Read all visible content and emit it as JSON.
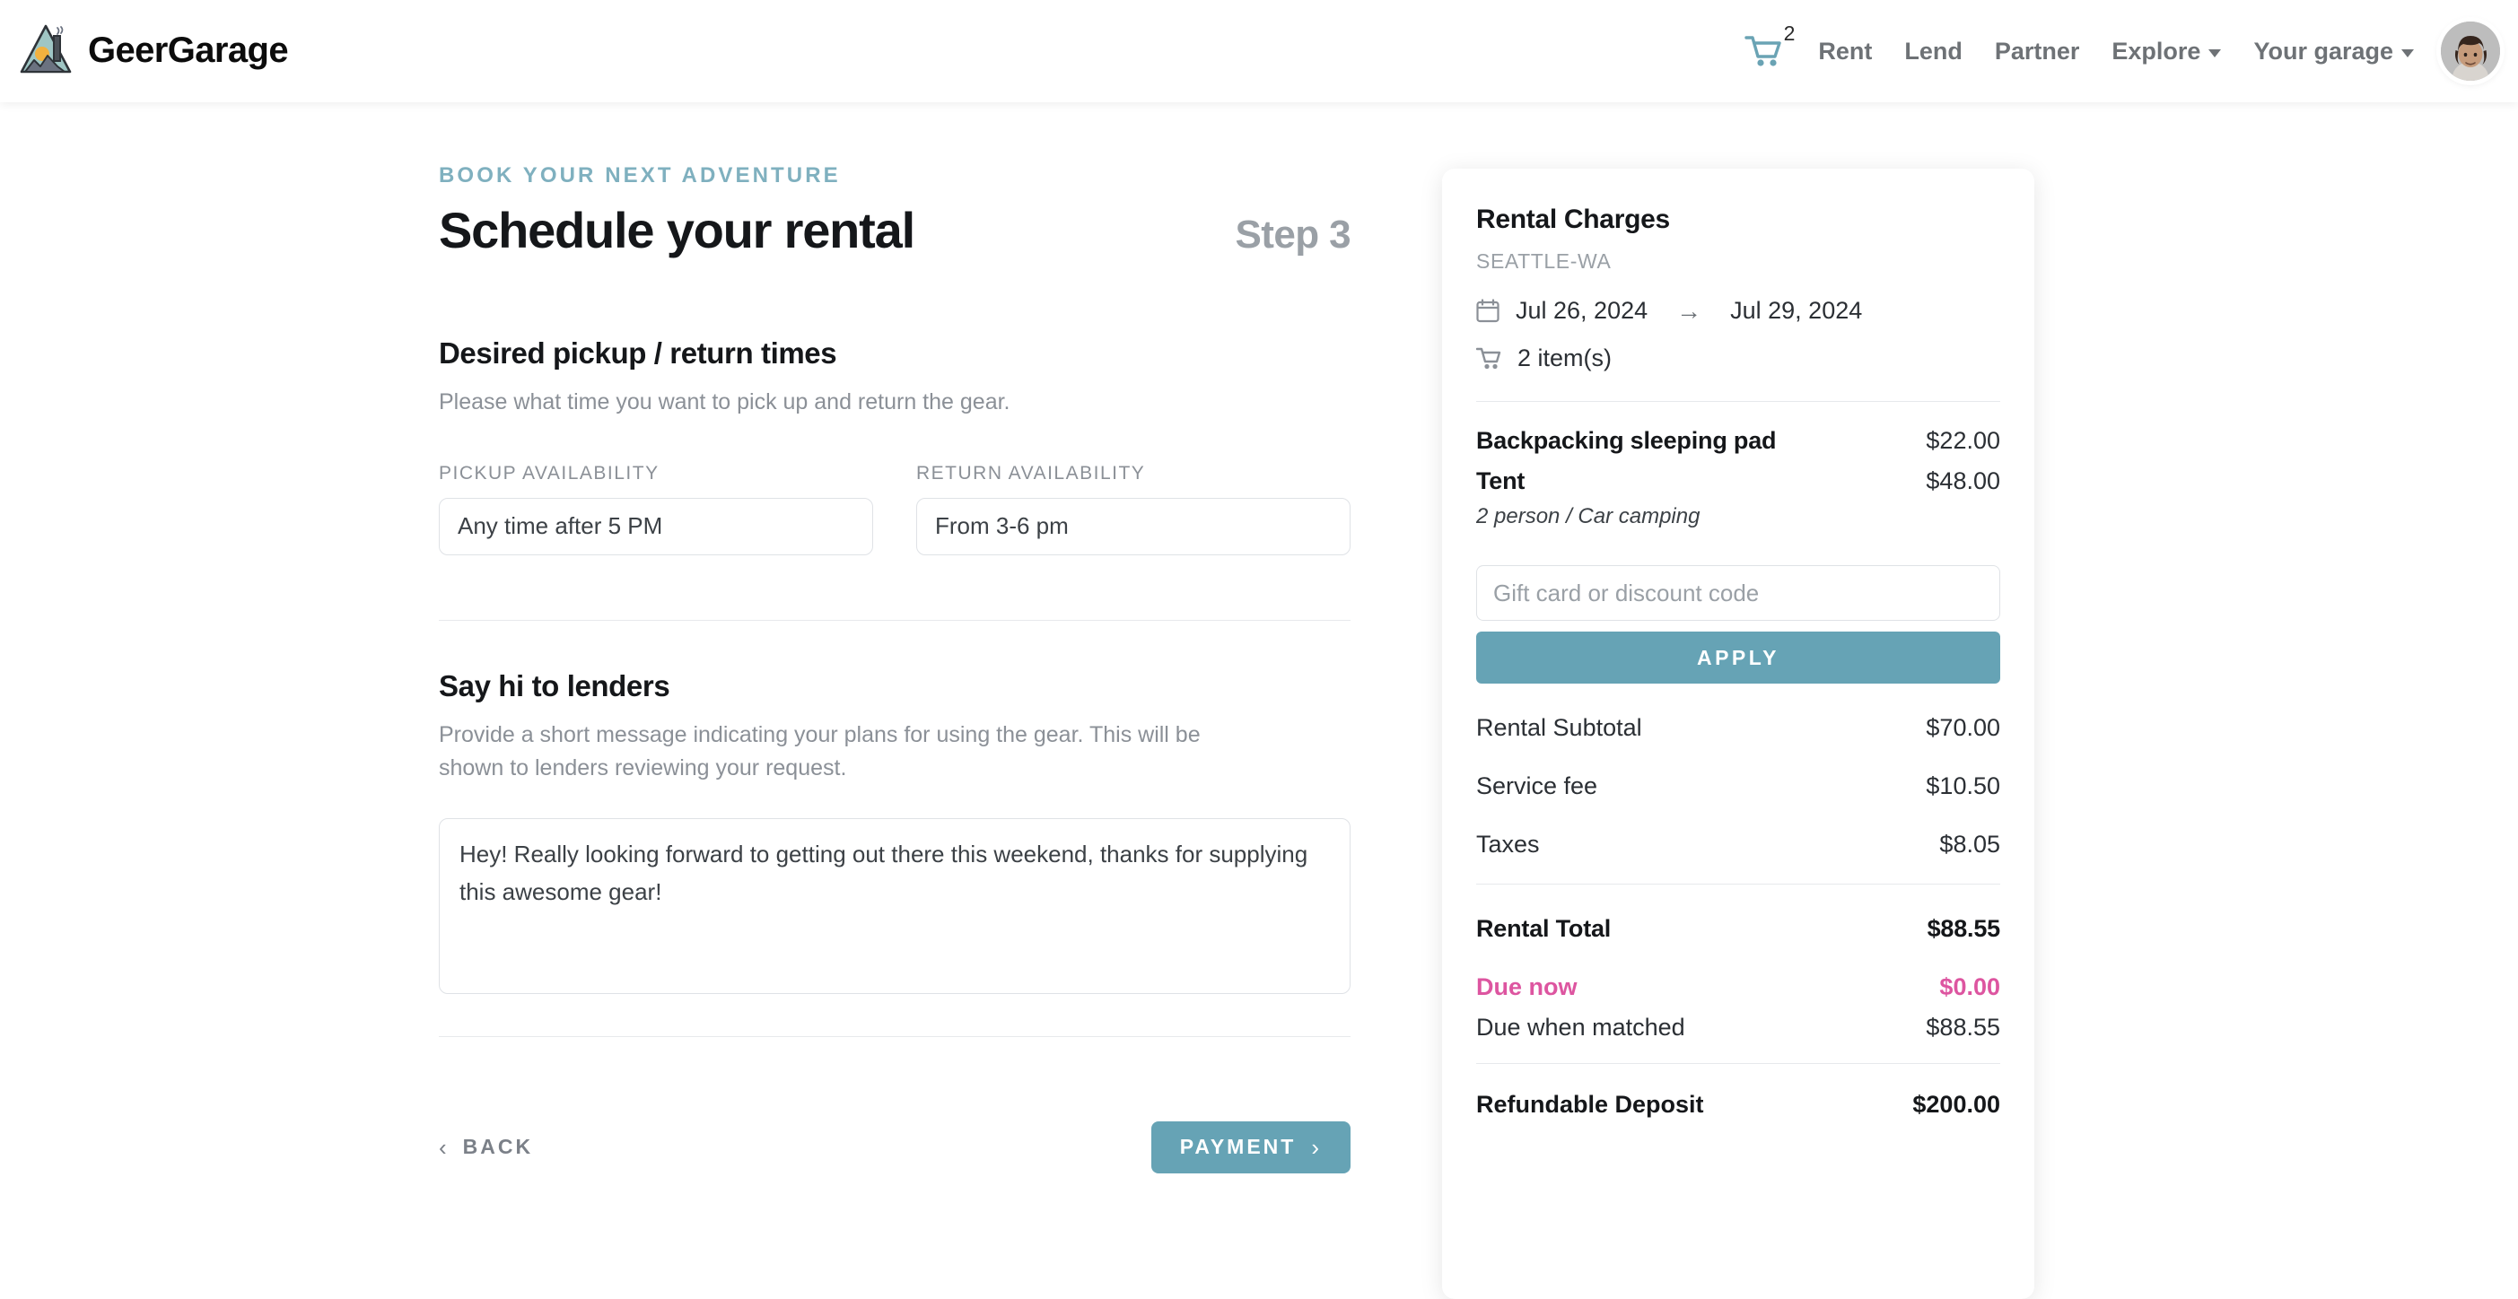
{
  "brand": {
    "name": "GeerGarage",
    "logo_icon": "mountain-tent-logo"
  },
  "nav": {
    "cart_icon": "shopping-cart-icon",
    "cart_count": "2",
    "links": [
      {
        "label": "Rent",
        "has_dropdown": false
      },
      {
        "label": "Lend",
        "has_dropdown": false
      },
      {
        "label": "Partner",
        "has_dropdown": false
      },
      {
        "label": "Explore",
        "has_dropdown": true
      },
      {
        "label": "Your garage",
        "has_dropdown": true
      }
    ],
    "avatar_icon": "user-avatar"
  },
  "main": {
    "eyebrow": "BOOK YOUR NEXT ADVENTURE",
    "title": "Schedule your rental",
    "step": "Step 3",
    "times_section": {
      "heading": "Desired pickup / return times",
      "subtext": "Please what time you want to pick up and return the gear.",
      "pickup_label": "PICKUP AVAILABILITY",
      "pickup_value": "Any time after 5 PM",
      "return_label": "RETURN AVAILABILITY",
      "return_value": "From 3-6 pm"
    },
    "message_section": {
      "heading": "Say hi to lenders",
      "subtext": "Provide a short message indicating your plans for using the gear. This will be shown to lenders reviewing your request.",
      "message_value": "Hey! Really looking forward to getting out there this weekend, thanks for supplying this awesome gear!"
    },
    "back_label": "BACK",
    "back_icon": "chevron-left-icon",
    "payment_label": "PAYMENT",
    "payment_icon": "chevron-right-icon"
  },
  "summary": {
    "title": "Rental Charges",
    "location": "SEATTLE-WA",
    "calendar_icon": "calendar-icon",
    "start_date": "Jul 26, 2024",
    "date_arrow_icon": "arrow-right-icon",
    "end_date": "Jul 29, 2024",
    "cart_icon": "shopping-cart-icon",
    "item_count_label": "2 item(s)",
    "items": [
      {
        "name": "Backpacking sleeping pad",
        "price": "$22.00",
        "sub": ""
      },
      {
        "name": "Tent",
        "price": "$48.00",
        "sub": "2 person / Car camping"
      }
    ],
    "promo_placeholder": "Gift card or discount code",
    "promo_value": "",
    "apply_label": "APPLY",
    "charges": [
      {
        "label": "Rental Subtotal",
        "value": "$70.00"
      },
      {
        "label": "Service fee",
        "value": "$10.50"
      },
      {
        "label": "Taxes",
        "value": "$8.05"
      }
    ],
    "total_label": "Rental Total",
    "total_value": "$88.55",
    "due_now_label": "Due now",
    "due_now_value": "$0.00",
    "due_matched_label": "Due when matched",
    "due_matched_value": "$88.55",
    "deposit_label": "Refundable Deposit",
    "deposit_value": "$200.00"
  },
  "colors": {
    "accent_teal": "#66a3b5",
    "eyebrow_teal": "#7fb0bf",
    "pink": "#dd55a0",
    "text_dark": "#15171a",
    "text_muted": "#8b9097"
  }
}
